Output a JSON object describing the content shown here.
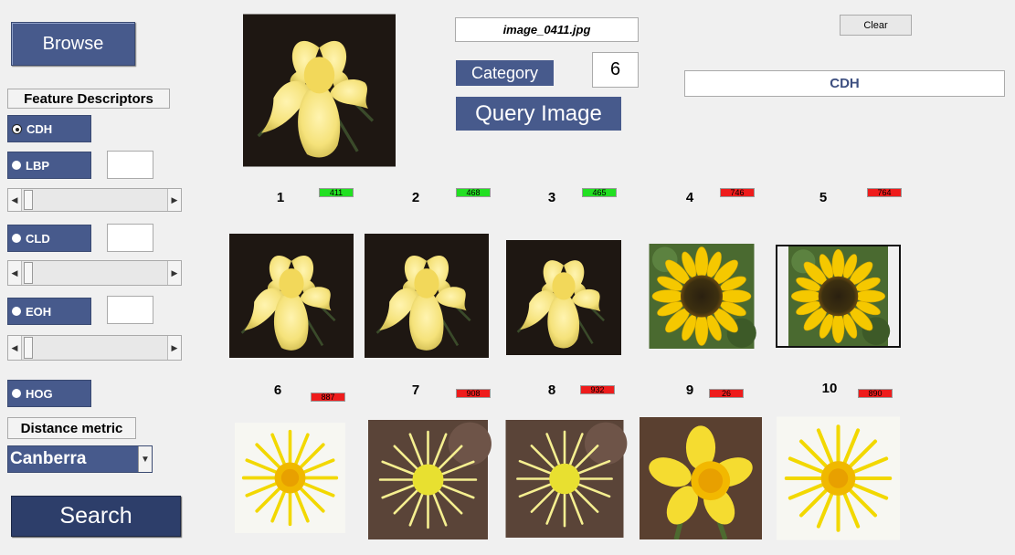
{
  "left_panel": {
    "browse_label": "Browse",
    "feature_descriptors_title": "Feature Descriptors",
    "descriptors": [
      {
        "label": "CDH",
        "selected": true
      },
      {
        "label": "LBP",
        "selected": false
      },
      {
        "label": "CLD",
        "selected": false
      },
      {
        "label": "EOH",
        "selected": false
      },
      {
        "label": "HOG",
        "selected": false
      }
    ],
    "distance_metric_title": "Distance metric",
    "distance_metric_value": "Canberra",
    "search_label": "Search"
  },
  "query": {
    "filename": "image_0411.jpg",
    "category_label": "Category",
    "category_value": "6",
    "query_image_label": "Query Image",
    "clear_label": "Clear",
    "descriptor_display": "CDH",
    "image": "yellow iris flower"
  },
  "results": [
    {
      "rank": "1",
      "score": "411",
      "match": true,
      "image": "yellow iris flower"
    },
    {
      "rank": "2",
      "score": "468",
      "match": true,
      "image": "yellow iris flower"
    },
    {
      "rank": "3",
      "score": "465",
      "match": true,
      "image": "yellow iris flower"
    },
    {
      "rank": "4",
      "score": "746",
      "match": false,
      "image": "sunflower"
    },
    {
      "rank": "5",
      "score": "764",
      "match": false,
      "image": "sunflower"
    },
    {
      "rank": "6",
      "score": "887",
      "match": false,
      "image": "yellow dandelion-like flower"
    },
    {
      "rank": "7",
      "score": "908",
      "match": false,
      "image": "yellow coltsfoot flower"
    },
    {
      "rank": "8",
      "score": "932",
      "match": false,
      "image": "yellow coltsfoot flower"
    },
    {
      "rank": "9",
      "score": "26",
      "match": false,
      "image": "yellow daffodil"
    },
    {
      "rank": "10",
      "score": "890",
      "match": false,
      "image": "yellow dandelion-like flower"
    }
  ],
  "colors": {
    "accent": "#475a8c",
    "search_button": "#2d3e6a",
    "match_green": "#22e022",
    "nonmatch_red": "#ee1c1c",
    "background": "#f0f0f0"
  }
}
